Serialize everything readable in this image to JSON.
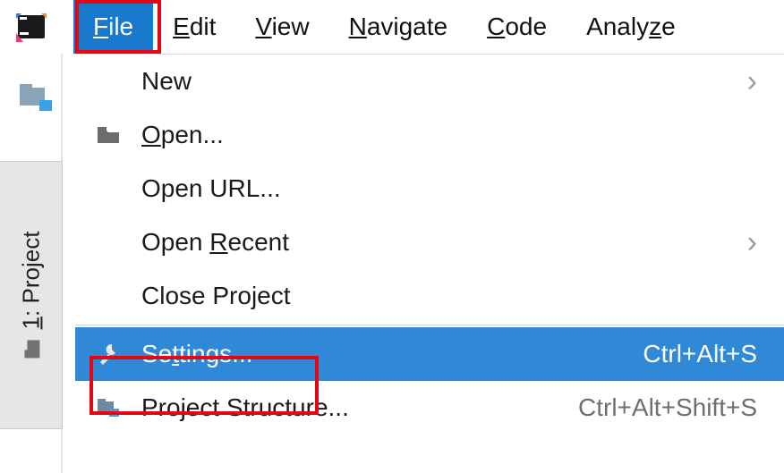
{
  "menubar": {
    "items": [
      {
        "pre": "",
        "mn": "F",
        "post": "ile",
        "active": true
      },
      {
        "pre": "",
        "mn": "E",
        "post": "dit",
        "active": false
      },
      {
        "pre": "",
        "mn": "V",
        "post": "iew",
        "active": false
      },
      {
        "pre": "",
        "mn": "N",
        "post": "avigate",
        "active": false
      },
      {
        "pre": "",
        "mn": "C",
        "post": "ode",
        "active": false
      },
      {
        "pre": "Analy",
        "mn": "z",
        "post": "e",
        "active": false
      }
    ]
  },
  "sidebar": {
    "project_tab_pre": "",
    "project_tab_mn": "1",
    "project_tab_post": ": Project"
  },
  "dropdown": {
    "items": [
      {
        "icon": "",
        "pre": "New",
        "mn": "",
        "post": "",
        "submenu": true,
        "shortcut": ""
      },
      {
        "icon": "folder",
        "pre": "",
        "mn": "O",
        "post": "pen...",
        "submenu": false,
        "shortcut": ""
      },
      {
        "icon": "",
        "pre": "Open URL...",
        "mn": "",
        "post": "",
        "submenu": false,
        "shortcut": ""
      },
      {
        "icon": "",
        "pre": "Open ",
        "mn": "R",
        "post": "ecent",
        "submenu": true,
        "shortcut": ""
      },
      {
        "icon": "",
        "pre": "Close Pro",
        "mn": "j",
        "post": "ect",
        "submenu": false,
        "shortcut": ""
      },
      {
        "sep": true
      },
      {
        "icon": "wrench",
        "pre": "Se",
        "mn": "t",
        "post": "tings...",
        "submenu": false,
        "shortcut": "Ctrl+Alt+S",
        "selected": true
      },
      {
        "icon": "project",
        "pre": "Project Structure...",
        "mn": "",
        "post": "",
        "submenu": false,
        "shortcut": "Ctrl+Alt+Shift+S"
      }
    ]
  }
}
